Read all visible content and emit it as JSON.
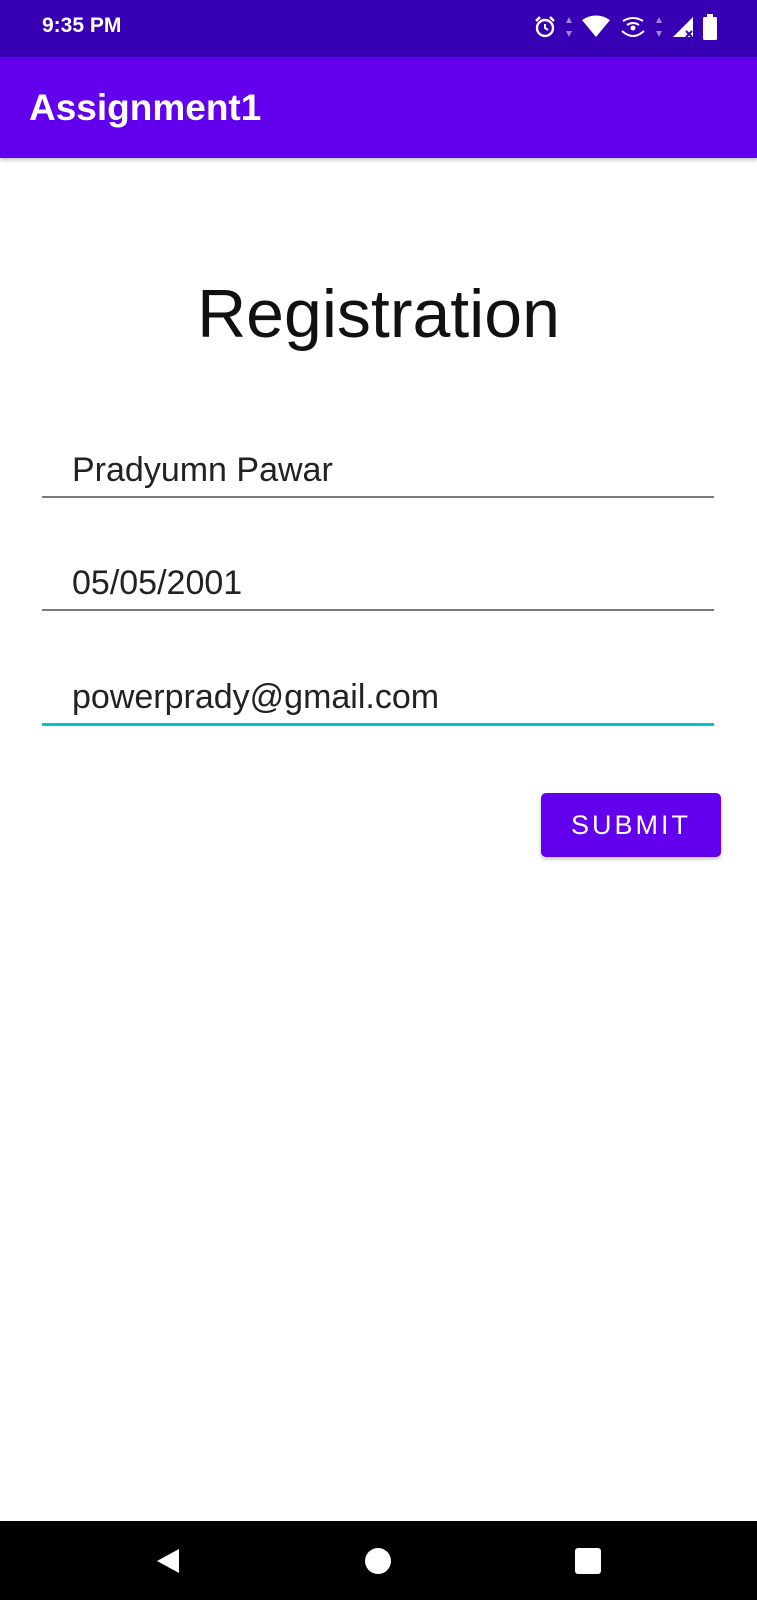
{
  "status_bar": {
    "time": "9:35 PM",
    "icons": [
      "alarm-icon",
      "data-arrows-icon",
      "wifi-icon",
      "hotspot-icon",
      "data-arrows-icon",
      "signal-icon",
      "battery-icon"
    ]
  },
  "app_bar": {
    "title": "Assignment1",
    "color": "#6200ee"
  },
  "main": {
    "heading": "Registration",
    "fields": {
      "name": "Pradyumn Pawar",
      "dob": "05/05/2001",
      "email": "powerprady@gmail.com"
    },
    "submit_label": "SUBMIT"
  },
  "colors": {
    "status_bar": "#3700b3",
    "primary": "#6200ee",
    "focus_underline": "#03c4c4"
  },
  "nav_bar": {
    "icons": [
      "back-icon",
      "home-icon",
      "recents-icon"
    ]
  }
}
